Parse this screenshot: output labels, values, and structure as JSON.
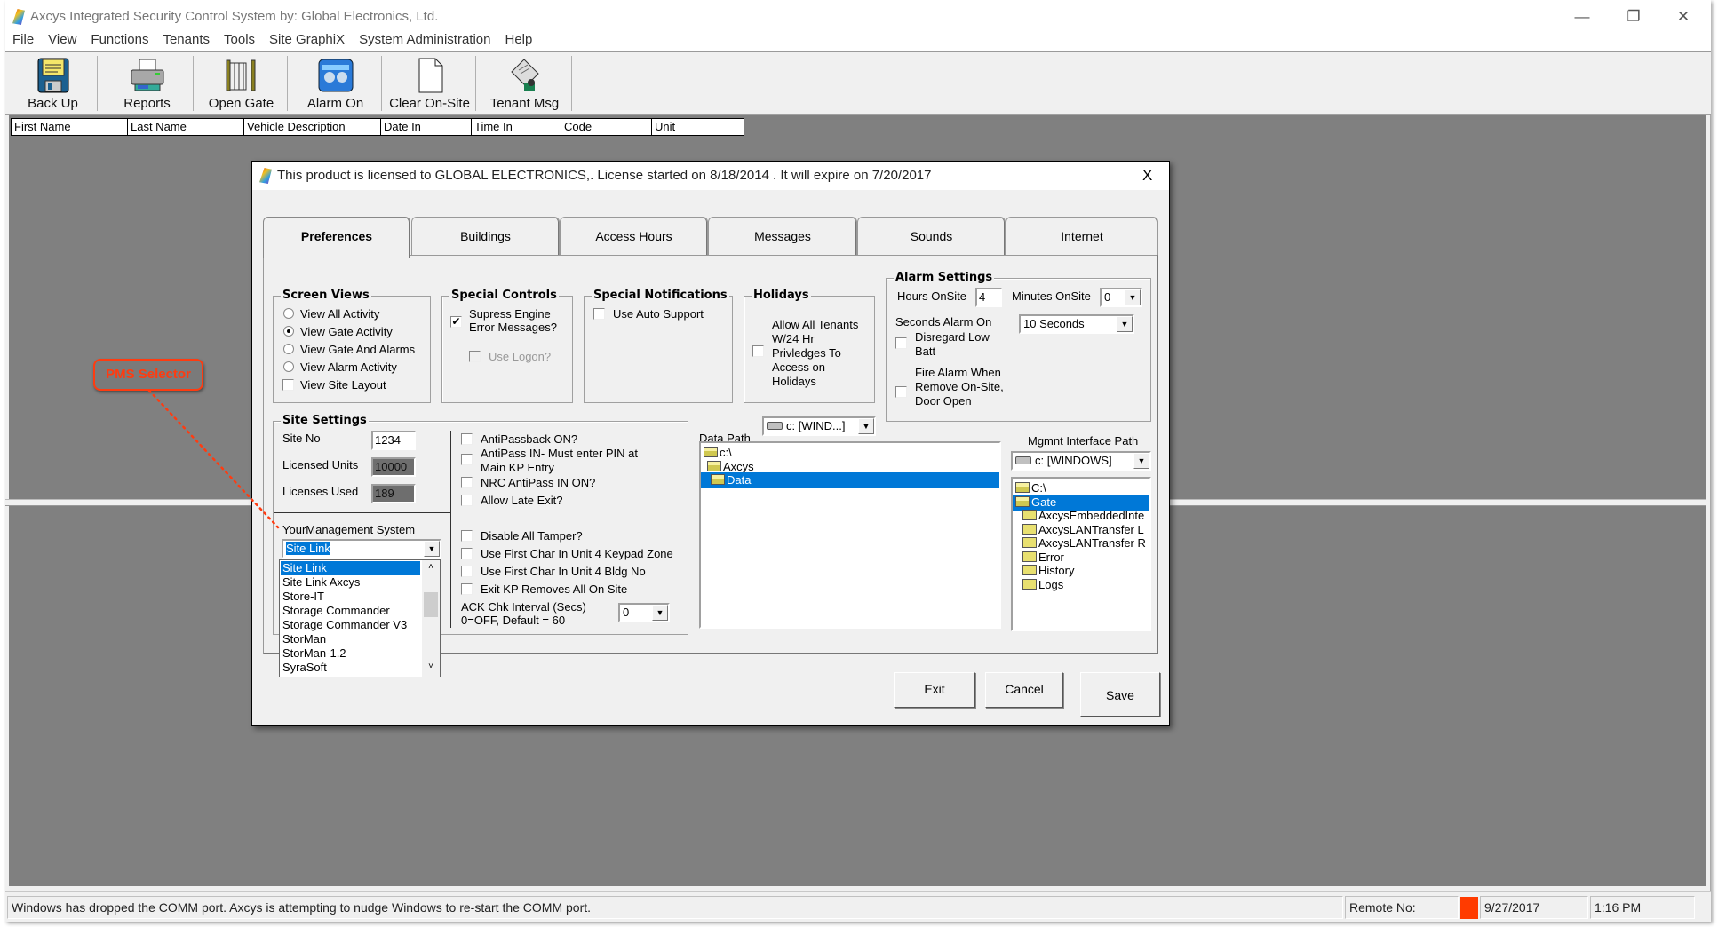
{
  "window": {
    "title": "Axcys Integrated Security Control System by:  Global Electronics, Ltd.",
    "minimize": "—",
    "restore": "❐",
    "close": "✕"
  },
  "menu": [
    "File",
    "View",
    "Functions",
    "Tenants",
    "Tools",
    "Site GraphiX",
    "System Administration",
    "Help"
  ],
  "toolbar": [
    {
      "label": "Back Up",
      "icon": "floppy-disk-icon"
    },
    {
      "label": "Reports",
      "icon": "printer-icon"
    },
    {
      "label": "Open Gate",
      "icon": "gate-icon"
    },
    {
      "label": "Alarm On",
      "icon": "alarm-icon"
    },
    {
      "label": "Clear On-Site",
      "icon": "blank-page-icon"
    },
    {
      "label": "Tenant Msg",
      "icon": "message-icon"
    }
  ],
  "table": {
    "columns": [
      "First Name",
      "Last Name",
      "Vehicle Description",
      "Date In",
      "Time In",
      "Code",
      "Unit"
    ]
  },
  "status": {
    "message": "Windows has dropped the COMM port.  Axcys is attempting to nudge Windows to re-start the COMM port.",
    "remote_label": "Remote No:",
    "indicator_color": "#ff3b00",
    "date": "9/27/2017",
    "time": "1:16 PM"
  },
  "annotation": {
    "label": "PMS Selector",
    "color": "#ff3b10"
  },
  "dialog": {
    "title": "This product is licensed to GLOBAL ELECTRONICS,. License started on 8/18/2014 . It will expire on 7/20/2017",
    "close": "X",
    "tabs": [
      "Preferences",
      "Buildings",
      "Access Hours",
      "Messages",
      "Sounds",
      "Internet"
    ],
    "active_tab": "Preferences",
    "screen_views": {
      "title": "Screen Views",
      "options": [
        {
          "label": "View All Activity",
          "type": "radio",
          "checked": false
        },
        {
          "label": "View Gate Activity",
          "type": "radio",
          "checked": true
        },
        {
          "label": "View Gate And Alarms",
          "type": "radio",
          "checked": false
        },
        {
          "label": "View Alarm Activity",
          "type": "radio",
          "checked": false
        },
        {
          "label": "View Site Layout",
          "type": "checkbox",
          "checked": false
        }
      ]
    },
    "special_controls": {
      "title": "Special Controls",
      "suppress_line1": "Supress Engine",
      "suppress_line2": "Error Messages?",
      "suppress_checked": true,
      "use_logon": "Use Logon?",
      "use_logon_checked": false
    },
    "special_notifications": {
      "title": "Special Notifications",
      "auto_support": "Use Auto Support",
      "auto_support_checked": false
    },
    "holidays": {
      "title": "Holidays",
      "lines": [
        "Allow All Tenants",
        "W/24 Hr",
        "Privledges To",
        "Access on",
        "Holidays"
      ],
      "checked": false
    },
    "alarm_settings": {
      "title": "Alarm Settings",
      "hours_label": "Hours OnSite",
      "hours_value": "4",
      "minutes_label": "Minutes OnSite",
      "minutes_value": "0",
      "seconds_label": "Seconds Alarm On",
      "seconds_value": "10 Seconds",
      "low_batt_line1": "Disregard Low",
      "low_batt_line2": "Batt",
      "low_batt_checked": false,
      "fire_line1": "Fire Alarm When",
      "fire_line2": "Remove On-Site,",
      "fire_line3": "Door Open",
      "fire_checked": false
    },
    "site_settings": {
      "title": "Site  Settings",
      "site_no_label": "Site No",
      "site_no": "1234",
      "licensed_units_label": "Licensed Units",
      "licensed_units": "10000",
      "licenses_used_label": "Licenses Used",
      "licenses_used": "189",
      "pms_label": "YourManagement System",
      "pms_value": "Site Link",
      "pms_options": [
        "Site Link",
        "Site Link Axcys",
        "Store-IT",
        "Storage Commander",
        "Storage Commander V3",
        "StorMan",
        "StorMan-1.2",
        "SyraSoft"
      ],
      "pms_selected": "Site Link",
      "options_a": [
        {
          "label": "AntiPassback ON?",
          "checked": false
        },
        {
          "label": "AntiPass IN- Must enter PIN at",
          "label2": "Main KP Entry",
          "checked": false
        },
        {
          "label": "NRC AntiPass IN ON?",
          "checked": false
        },
        {
          "label": "Allow Late Exit?",
          "checked": false
        }
      ],
      "options_b": [
        {
          "label": "Disable All Tamper?",
          "checked": false
        },
        {
          "label": "Use First Char In Unit 4 Keypad Zone",
          "checked": false
        },
        {
          "label": "Use First Char In Unit 4 Bldg No",
          "checked": false
        },
        {
          "label": "Exit KP Removes All On Site",
          "checked": false
        }
      ],
      "ack_line1": "ACK Chk Interval (Secs)",
      "ack_line2": "0=OFF,  Default = 60",
      "ack_value": "0"
    },
    "data_path": {
      "label": "Data Path",
      "drive": "c: [WIND...]",
      "tree": [
        {
          "label": "c:\\",
          "level": 0,
          "selected": false
        },
        {
          "label": "Axcys",
          "level": 1,
          "selected": false
        },
        {
          "label": "Data",
          "level": 2,
          "selected": true
        }
      ]
    },
    "mgmt_path": {
      "label": "Mgmnt Interface Path",
      "drive": "c: [WINDOWS]",
      "tree": [
        {
          "label": "C:\\",
          "level": 0,
          "selected": false,
          "open": true
        },
        {
          "label": "Gate",
          "level": 0,
          "selected": true,
          "open": true
        },
        {
          "label": "AxcysEmbeddedInte",
          "level": 1,
          "selected": false,
          "open": false
        },
        {
          "label": "AxcysLANTransfer L",
          "level": 1,
          "selected": false,
          "open": false
        },
        {
          "label": "AxcysLANTransfer R",
          "level": 1,
          "selected": false,
          "open": false
        },
        {
          "label": "Error",
          "level": 1,
          "selected": false,
          "open": false
        },
        {
          "label": "History",
          "level": 1,
          "selected": false,
          "open": false
        },
        {
          "label": "Logs",
          "level": 1,
          "selected": false,
          "open": false
        }
      ]
    },
    "buttons": {
      "exit": "Exit",
      "cancel": "Cancel",
      "save": "Save"
    }
  }
}
